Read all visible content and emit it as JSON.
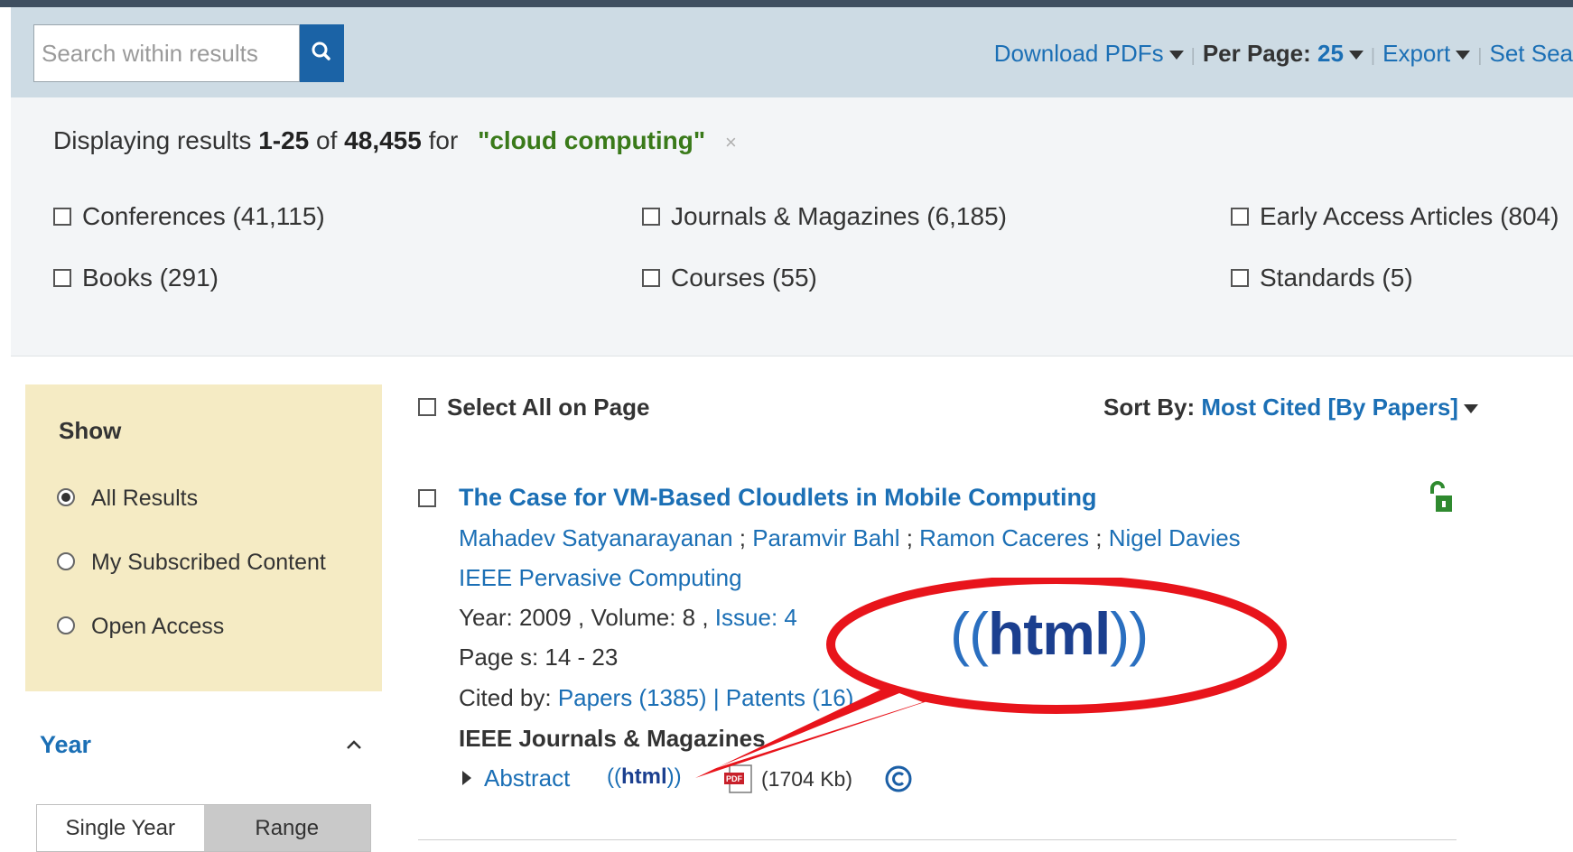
{
  "toolbar": {
    "search_placeholder": "Search within results",
    "download_pdfs": "Download PDFs",
    "per_page_label": "Per Page:",
    "per_page_value": "25",
    "export": "Export",
    "set_search": "Set Sea"
  },
  "results_summary": {
    "prefix": "Displaying results",
    "range": "1-25",
    "of": "of",
    "total": "48,455",
    "for": "for",
    "query": "\"cloud computing\"",
    "remove": "×"
  },
  "content_types": [
    {
      "label": "Conferences (41,115)"
    },
    {
      "label": "Journals & Magazines (6,185)"
    },
    {
      "label": "Early Access Articles (804)"
    },
    {
      "label": "Books (291)"
    },
    {
      "label": "Courses (55)"
    },
    {
      "label": "Standards (5)"
    }
  ],
  "sidebar": {
    "show_title": "Show",
    "options": [
      {
        "label": "All Results",
        "selected": true
      },
      {
        "label": "My Subscribed Content",
        "selected": false
      },
      {
        "label": "Open Access",
        "selected": false
      }
    ],
    "year_title": "Year",
    "year_tabs": [
      "Single Year",
      "Range"
    ]
  },
  "results_header": {
    "select_all": "Select All on Page",
    "sort_by_label": "Sort By:",
    "sort_by_value": "Most Cited [By Papers]"
  },
  "result": {
    "title": "The Case for VM-Based Cloudlets in Mobile Computing",
    "authors": [
      "Mahadev Satyanarayanan",
      "Paramvir Bahl",
      "Ramon Caceres",
      "Nigel Davies"
    ],
    "author_sep": " ; ",
    "publication": "IEEE Pervasive Computing",
    "year_text": "Year: 2009 , Volume: 8 , ",
    "issue_text": "Issue: 4",
    "pages_text": "Page s: 14 - 23",
    "cited_by_label": "Cited by: ",
    "cited_papers": "Papers (1385)",
    "cited_sep": " | ",
    "cited_patents": "Patents (16)",
    "pub_type": "IEEE Journals & Magazines",
    "abstract": "Abstract",
    "html_label": "html",
    "pdf_size": "(1704 Kb)"
  },
  "callout": {
    "label": "html",
    "color": "#e8141b"
  },
  "colors": {
    "link": "#1b6fb5",
    "toolbar_bg": "#cddbe4",
    "sidebar_bg": "#f5ebc4",
    "query_green": "#3a7a1a"
  }
}
